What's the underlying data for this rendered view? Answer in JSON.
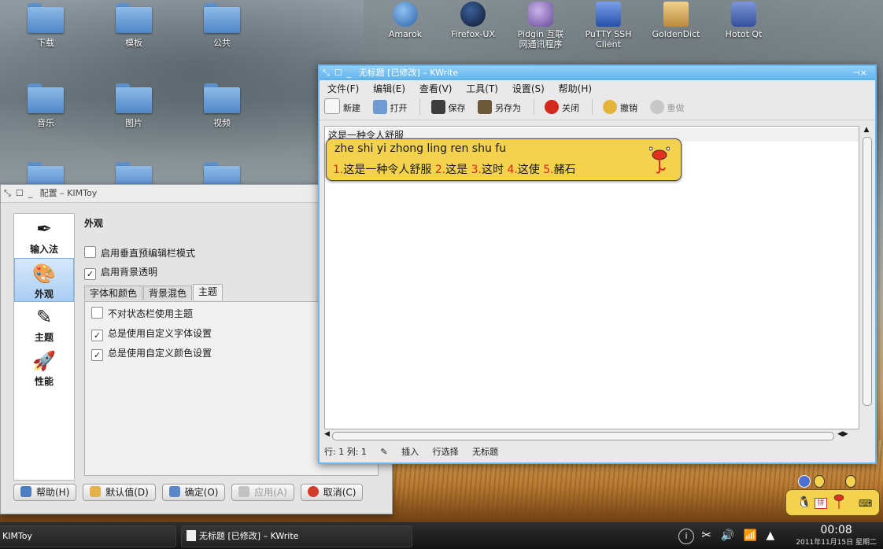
{
  "desktop": {
    "folders": [
      {
        "label": "下载"
      },
      {
        "label": "模板"
      },
      {
        "label": "公共"
      },
      {
        "label": "音乐"
      },
      {
        "label": "图片"
      },
      {
        "label": "视频"
      }
    ],
    "launchers": [
      {
        "label": "Amarok",
        "color": "#3d7fc1"
      },
      {
        "label": "Firefox-UX",
        "color": "#1b2d4c"
      },
      {
        "label": "Pidgin 互联\n网通讯程序",
        "color": "#8a6ab5"
      },
      {
        "label": "PuTTY SSH\nClient",
        "color": "#3264c8"
      },
      {
        "label": "GoldenDict",
        "color": "#d8a24a"
      },
      {
        "label": "Hotot Qt",
        "color": "#4663b0"
      }
    ]
  },
  "kimtoy": {
    "title": "配置 – KIMToy",
    "sidebar": [
      {
        "label": "输入法",
        "icon": "pen-icon"
      },
      {
        "label": "外观",
        "icon": "palette-icon"
      },
      {
        "label": "主题",
        "icon": "theme-icon"
      },
      {
        "label": "性能",
        "icon": "rocket-icon"
      }
    ],
    "section_title": "外观",
    "options": {
      "vertical_preedit": "启用垂直预编辑栏模式",
      "bg_transparent": "启用背景透明"
    },
    "tabs": [
      "字体和颜色",
      "背景混色",
      "主题"
    ],
    "theme_options": {
      "no_statusbar_theme": "不对状态栏使用主题",
      "custom_font": "总是使用自定义字体设置",
      "custom_color": "总是使用自定义颜色设置"
    },
    "buttons": {
      "help": "帮助(H)",
      "defaults": "默认值(D)",
      "ok": "确定(O)",
      "apply": "应用(A)",
      "cancel": "取消(C)"
    }
  },
  "kwrite": {
    "title": "无标题 [已修改] – KWrite",
    "menu": [
      "文件(F)",
      "编辑(E)",
      "查看(V)",
      "工具(T)",
      "设置(S)",
      "帮助(H)"
    ],
    "toolbar": {
      "new": "新建",
      "open": "打开",
      "save": "保存",
      "save_as": "另存为",
      "close": "关闭",
      "undo": "撤销",
      "redo": "重做"
    },
    "editor_text": "这是一种令人舒服",
    "status": {
      "position": "行: 1 列: 1",
      "mode": "插入",
      "selection": "行选择",
      "doc_name": "无标题"
    }
  },
  "ime_popup": {
    "preedit": "zhe shi yi zhong ling ren shu fu",
    "candidates": [
      {
        "num": "1.",
        "text": "这是一种令人舒服"
      },
      {
        "num": "2.",
        "text": "这是"
      },
      {
        "num": "3.",
        "text": "这时"
      },
      {
        "num": "4.",
        "text": "这使"
      },
      {
        "num": "5.",
        "text": "赭石"
      }
    ]
  },
  "taskbar": {
    "task_kimtoy": "KIMToy",
    "task_kwrite": "无标题 [已修改] – KWrite",
    "time": "00:08",
    "date": "2011年11月15日 星期二"
  }
}
